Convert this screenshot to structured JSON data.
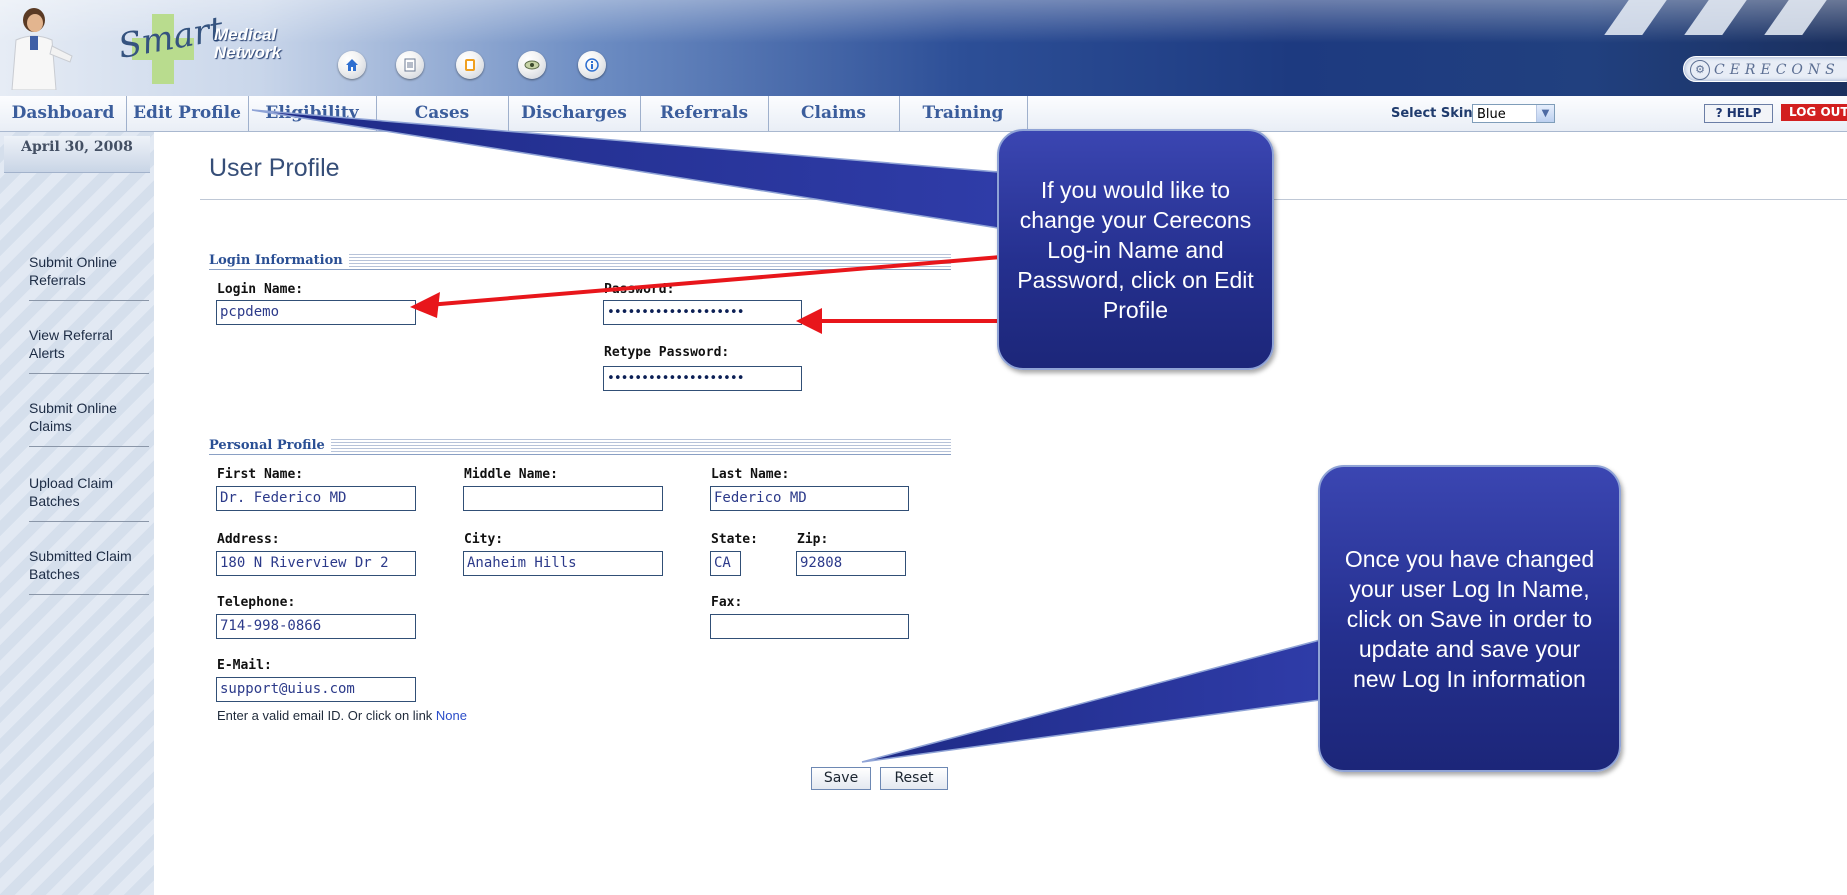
{
  "header": {
    "logo_script": "Smart",
    "logo_line1": "Medical",
    "logo_line2": "Network",
    "icons": [
      "home-icon",
      "document-icon",
      "clipboard-icon",
      "eye-icon",
      "info-icon"
    ],
    "brand_badge": "CERECONS"
  },
  "nav": {
    "tabs": [
      {
        "label": "Dashboard"
      },
      {
        "label": "Edit Profile"
      },
      {
        "label": "Eligibility"
      },
      {
        "label": "Cases"
      },
      {
        "label": "Discharges"
      },
      {
        "label": "Referrals"
      },
      {
        "label": "Claims"
      },
      {
        "label": "Training"
      }
    ],
    "skin_label": "Select Skin:",
    "skin_value": "Blue",
    "help_label": "? HELP",
    "logout_label": "LOG OUT"
  },
  "sidebar": {
    "date": "April 30, 2008",
    "items": [
      {
        "line1": "Submit Online",
        "line2": "Referrals"
      },
      {
        "line1": "View Referral",
        "line2": "Alerts"
      },
      {
        "line1": "Submit Online",
        "line2": "Claims"
      },
      {
        "line1": "Upload Claim",
        "line2": "Batches"
      },
      {
        "line1": "Submitted Claim",
        "line2": "Batches"
      }
    ]
  },
  "main": {
    "title": "User Profile",
    "login_section": "Login Information",
    "login_name_label": "Login Name:",
    "login_name_value": "pcpdemo",
    "password_label": "Password:",
    "password_value": "••••••••••••••••••••",
    "retype_label": "Retype Password:",
    "retype_value": "••••••••••••••••••••",
    "personal_section": "Personal Profile",
    "first_name_label": "First Name:",
    "first_name_value": "Dr. Federico MD",
    "middle_name_label": "Middle Name:",
    "middle_name_value": "",
    "last_name_label": "Last Name:",
    "last_name_value": "Federico MD",
    "address_label": "Address:",
    "address_value": "180 N Riverview Dr 2",
    "city_label": "City:",
    "city_value": "Anaheim Hills",
    "state_label": "State:",
    "state_value": "CA",
    "zip_label": "Zip:",
    "zip_value": "92808",
    "telephone_label": "Telephone:",
    "telephone_value": "714-998-0866",
    "fax_label": "Fax:",
    "fax_value": "",
    "email_label": "E-Mail:",
    "email_value": "support@uius.com",
    "email_hint": "Enter a valid email ID. Or click on link ",
    "email_hint_link": "None",
    "save_label": "Save",
    "reset_label": "Reset"
  },
  "callouts": {
    "top": "If you would like to change your Cerecons  Log-in Name and Password, click on Edit Profile",
    "bottom": "Once you have changed your user Log In Name, click on Save in order to update and save your new Log In information"
  },
  "colors": {
    "callout_fill": "#25308f",
    "arrow": "#e8161b",
    "nav_text": "#3b5d9c",
    "logout": "#d21f1f"
  }
}
